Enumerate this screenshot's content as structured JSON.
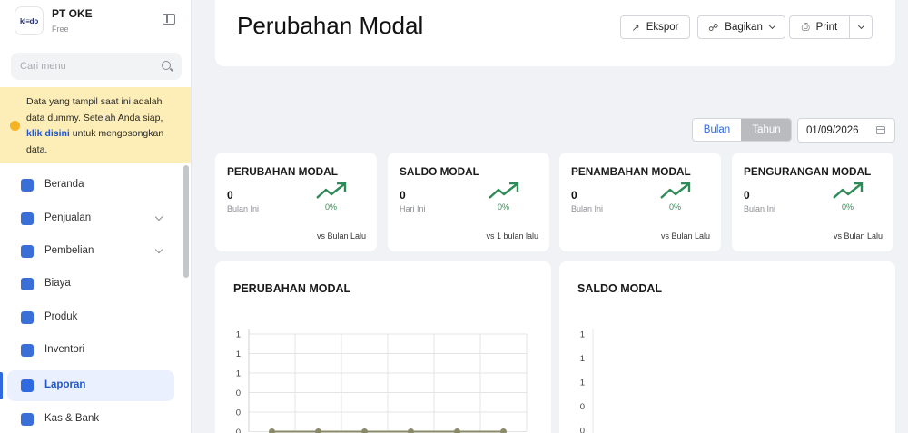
{
  "sidebar": {
    "brand": {
      "logo_text": "kl≡do",
      "company": "PT OKE",
      "plan": "Free"
    },
    "search": {
      "placeholder": "Cari menu"
    },
    "notice": {
      "text_before": "Data yang tampil saat ini adalah data dummy. Setelah Anda siap, ",
      "link": "klik disini",
      "text_after": " untuk mengosongkan data."
    },
    "items": [
      {
        "label": "Beranda",
        "icon": "home-icon",
        "color": "#3a6fd8",
        "expandable": false
      },
      {
        "label": "Penjualan",
        "icon": "sales-tag-icon",
        "color": "#3a6fd8",
        "expandable": true
      },
      {
        "label": "Pembelian",
        "icon": "purchase-cart-icon",
        "color": "#3a6fd8",
        "expandable": true
      },
      {
        "label": "Biaya",
        "icon": "receipt-icon",
        "color": "#3a6fd8",
        "expandable": false
      },
      {
        "label": "Produk",
        "icon": "box-icon",
        "color": "#3a6fd8",
        "expandable": false
      },
      {
        "label": "Inventori",
        "icon": "warehouse-icon",
        "color": "#3a6fd8",
        "expandable": false
      },
      {
        "label": "Laporan",
        "icon": "report-icon",
        "color": "#2f6ae0",
        "expandable": false,
        "active": true
      },
      {
        "label": "Kas & Bank",
        "icon": "wallet-icon",
        "color": "#3a6fd8",
        "expandable": false
      }
    ]
  },
  "header": {
    "title": "Perubahan Modal",
    "ekspor": "Ekspor",
    "bagikan": "Bagikan",
    "print": "Print"
  },
  "filters": {
    "bulan": "Bulan",
    "tahun": "Tahun",
    "selected": "Tahun",
    "date": "01/09/2026"
  },
  "kpis": [
    {
      "title": "PERUBAHAN MODAL",
      "value": "0",
      "period": "Bulan Ini",
      "change": "0%",
      "compare": "vs Bulan Lalu"
    },
    {
      "title": "SALDO MODAL",
      "value": "0",
      "period": "Hari Ini",
      "change": "0%",
      "compare": "vs 1 bulan lalu"
    },
    {
      "title": "PENAMBAHAN MODAL",
      "value": "0",
      "period": "Bulan Ini",
      "change": "0%",
      "compare": "vs Bulan Lalu"
    },
    {
      "title": "PENGURANGAN MODAL",
      "value": "0",
      "period": "Bulan Ini",
      "change": "0%",
      "compare": "vs Bulan Lalu"
    }
  ],
  "colors": {
    "accent": "#2f6ae0",
    "trend_up": "#2e8b57",
    "line_series": "#8a8a6a"
  },
  "chart_data": [
    {
      "type": "line",
      "title": "PERUBAHAN MODAL",
      "ytick_labels": [
        "1",
        "1",
        "1",
        "0",
        "0",
        "0"
      ],
      "x_count": 6,
      "values": [
        0,
        0,
        0,
        0,
        0,
        0
      ],
      "grid": true
    },
    {
      "type": "line",
      "title": "SALDO MODAL",
      "ytick_labels": [
        "1",
        "1",
        "1",
        "0",
        "0"
      ],
      "values": [],
      "grid": false
    }
  ]
}
